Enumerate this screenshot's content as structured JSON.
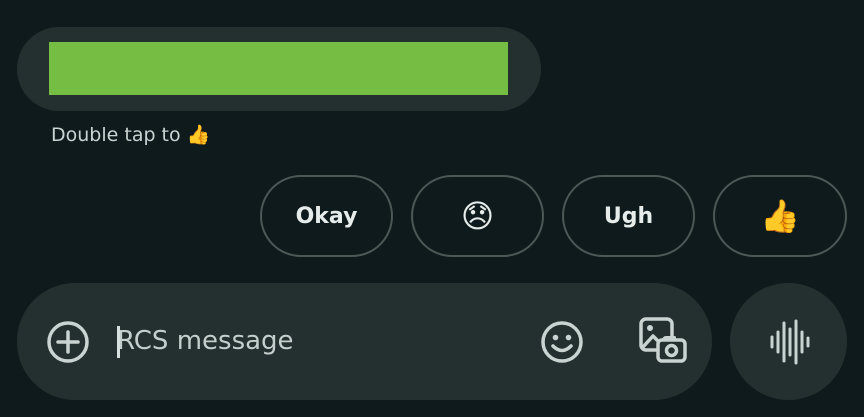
{
  "message": {
    "hint_text": "Double tap to",
    "hint_emoji": "👍",
    "redaction_color": "#76bd43"
  },
  "smart_replies": [
    {
      "label": "Okay"
    },
    {
      "label": "😞"
    },
    {
      "label": "Ugh"
    },
    {
      "label": "👍"
    }
  ],
  "composer": {
    "placeholder": "RCS message",
    "value": "",
    "icons": {
      "add": "add-circle-icon",
      "emoji": "emoji-smile-icon",
      "gallery": "gallery-camera-icon",
      "voice": "voice-waveform-icon"
    }
  },
  "colors": {
    "background": "#0f1a1c",
    "surface": "#24302f",
    "icon": "#c9d3d1"
  }
}
